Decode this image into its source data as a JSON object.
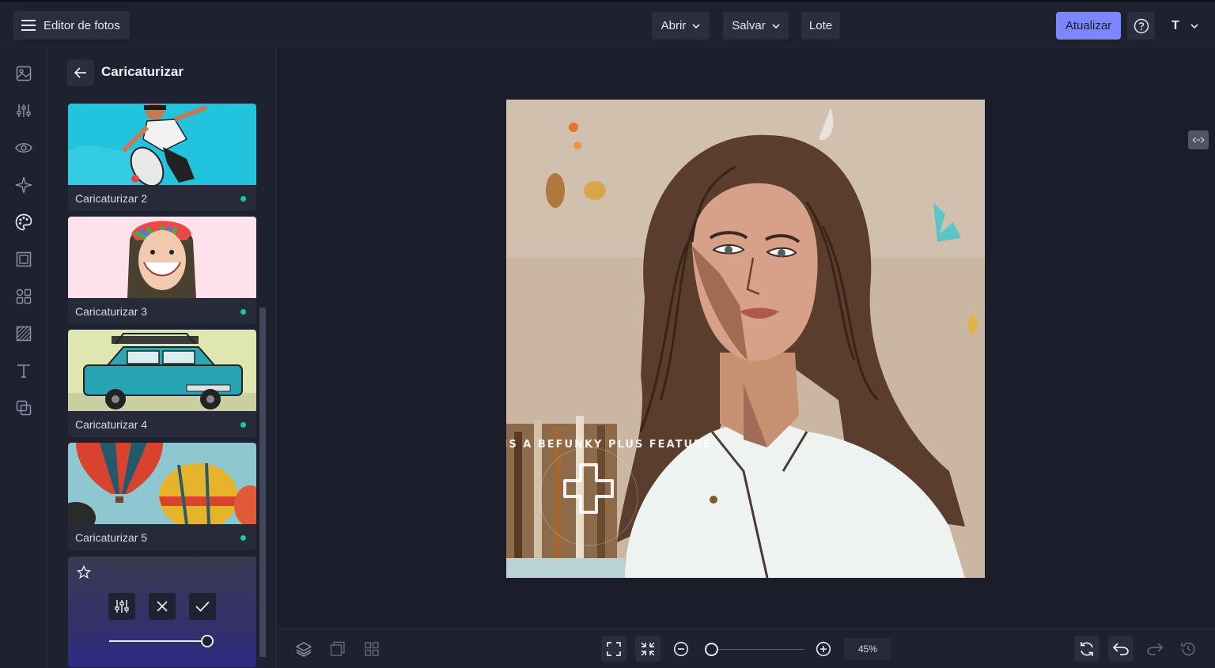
{
  "app": {
    "menu_icon": "hamburger-icon",
    "title": "Editor de fotos"
  },
  "toolbar": {
    "open_label": "Abrir",
    "save_label": "Salvar",
    "batch_label": "Lote",
    "upgrade_label": "Atualizar",
    "help_icon": "help-circle-icon",
    "user_initial": "T"
  },
  "rail": {
    "items": [
      "image-icon",
      "sliders-icon",
      "eye-icon",
      "sparkles-icon",
      "palette-icon",
      "frame-icon",
      "grid-icon",
      "texture-icon",
      "text-icon",
      "overlay-icon"
    ],
    "active": "palette-icon"
  },
  "panel": {
    "title": "Caricaturizar",
    "cards": [
      {
        "label": "Caricaturizar 2",
        "status": "active"
      },
      {
        "label": "Caricaturizar 3",
        "status": "active"
      },
      {
        "label": "Caricaturizar 4",
        "status": "active"
      },
      {
        "label": "Caricaturizar 5",
        "status": "active"
      }
    ],
    "adjust": {
      "intensity": 1.0
    }
  },
  "watermark": "THIS IS A BEFUNKY PLUS FEATURE",
  "bottom": {
    "zoom": "45%"
  },
  "colors": {
    "accent": "#7c86ff",
    "status_dot": "#19c7a3",
    "background": "#1c1f2b"
  }
}
